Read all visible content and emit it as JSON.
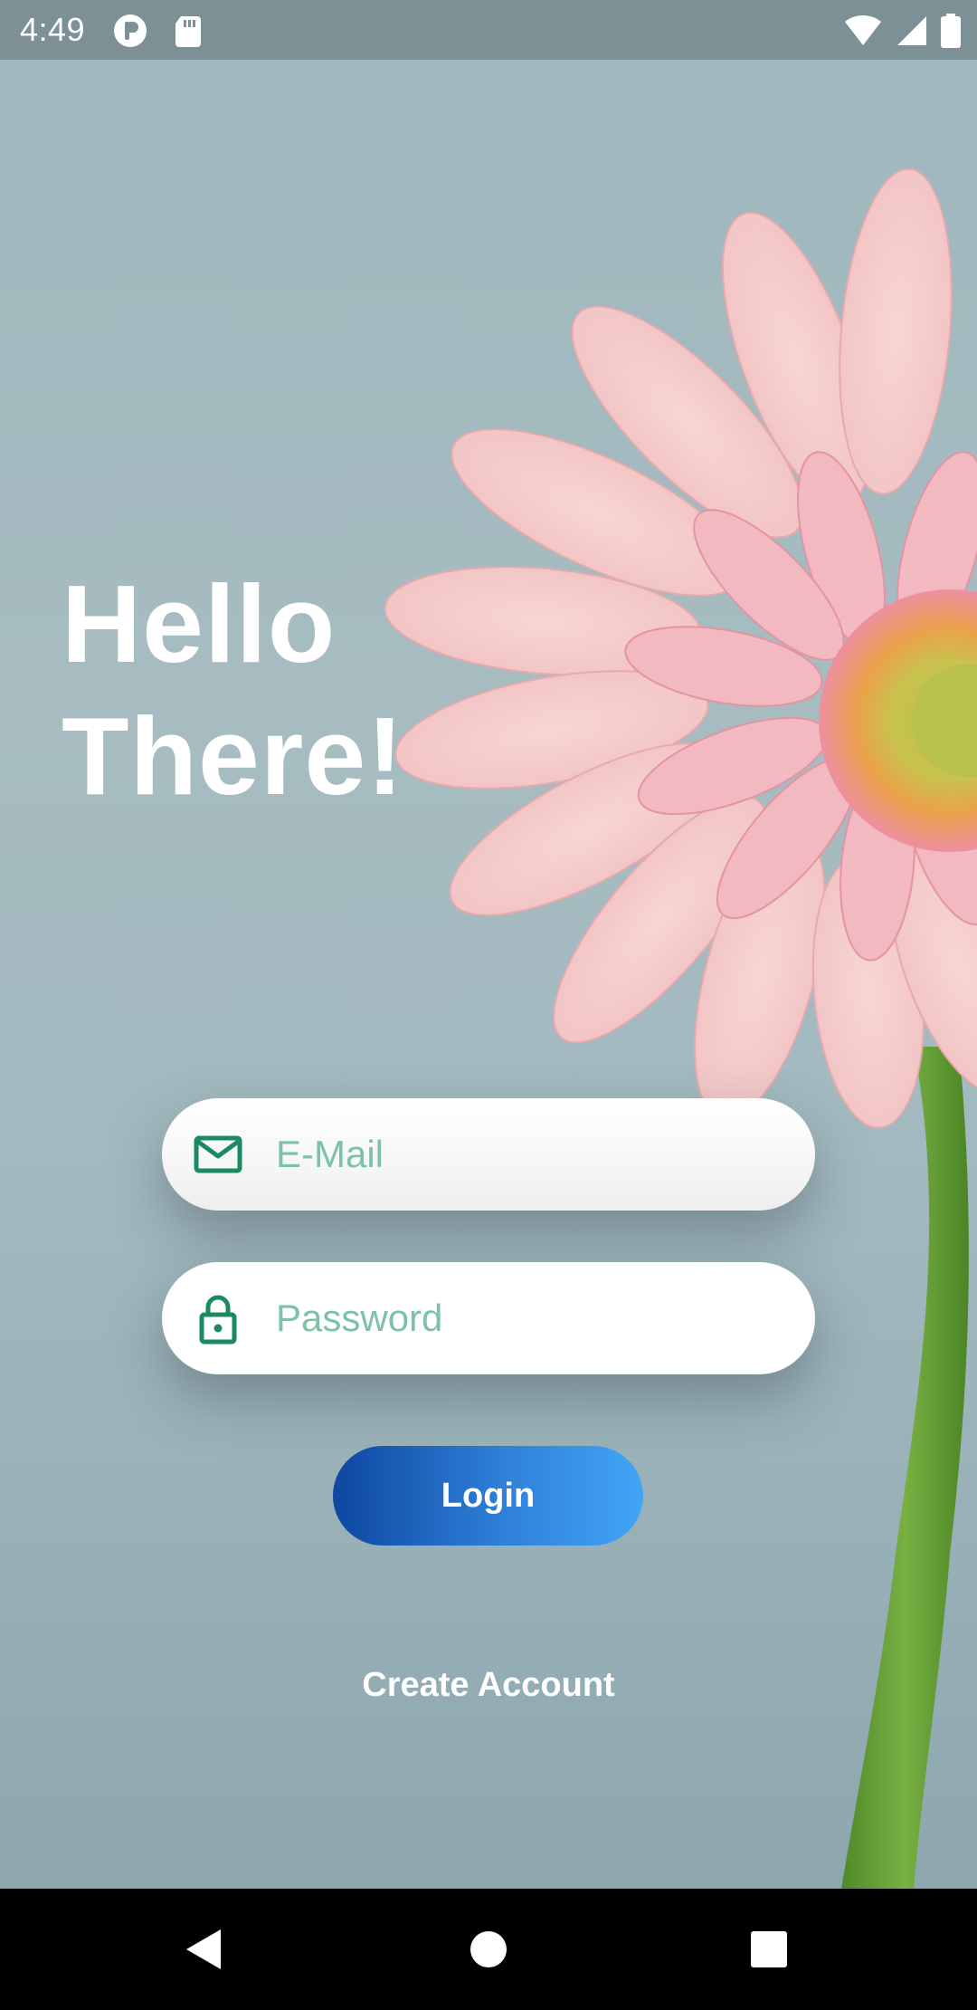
{
  "status_bar": {
    "time": "4:49",
    "left_icons": [
      "app-notification-icon",
      "sd-card-icon"
    ],
    "right_icons": [
      "wifi-icon",
      "signal-icon",
      "battery-icon"
    ]
  },
  "hero": {
    "title": "Hello\nThere!"
  },
  "form": {
    "email": {
      "placeholder": "E-Mail",
      "value": "",
      "icon": "mail-icon"
    },
    "password": {
      "placeholder": "Password",
      "value": "",
      "icon": "lock-icon"
    },
    "login_label": "Login",
    "create_account_label": "Create Account"
  },
  "nav_bar": {
    "buttons": [
      "back-icon",
      "home-icon",
      "recents-icon"
    ]
  },
  "colors": {
    "accent_green": "#1b8a5f",
    "placeholder_green": "#7cc2a5",
    "button_gradient_start": "#0d47a1",
    "button_gradient_end": "#42a5f5",
    "background": "#a4bbc0"
  }
}
